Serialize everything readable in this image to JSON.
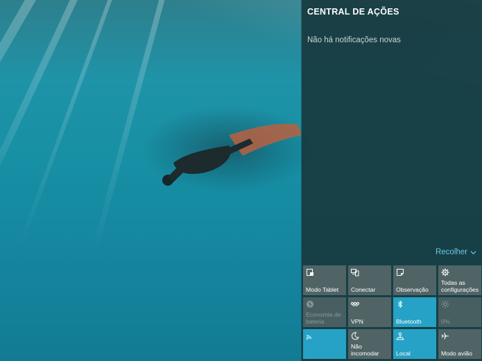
{
  "action_center": {
    "title": "CENTRAL DE AÇÕES",
    "empty_message": "Não há notificações novas",
    "collapse_label": "Recolher"
  },
  "quick_actions": [
    {
      "label": "Modo Tablet",
      "icon": "tablet-mode-icon",
      "state": "off"
    },
    {
      "label": "Conectar",
      "icon": "connect-icon",
      "state": "off"
    },
    {
      "label": "Observação",
      "icon": "note-icon",
      "state": "off"
    },
    {
      "label": "Todas as configurações",
      "icon": "gear-icon",
      "state": "off"
    },
    {
      "label": "Economia de bateria",
      "icon": "battery-saver-icon",
      "state": "disabled"
    },
    {
      "label": "VPN",
      "icon": "vpn-icon",
      "state": "off"
    },
    {
      "label": "Bluetooth",
      "icon": "bluetooth-icon",
      "state": "on"
    },
    {
      "label": "0%",
      "icon": "brightness-icon",
      "state": "disabled"
    },
    {
      "label": "",
      "icon": "wifi-icon",
      "state": "on"
    },
    {
      "label": "Não incomodar",
      "icon": "moon-icon",
      "state": "off"
    },
    {
      "label": "Local",
      "icon": "location-icon",
      "state": "on"
    },
    {
      "label": "Modo avião",
      "icon": "airplane-icon",
      "state": "off"
    }
  ],
  "colors": {
    "panel_bg": "#183a40",
    "tile_on": "#25a2c5",
    "tile_off": "#606e70",
    "link": "#6fc7e6"
  }
}
